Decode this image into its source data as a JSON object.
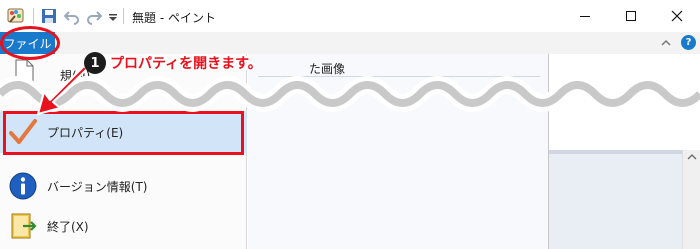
{
  "window": {
    "title": "無題 - ペイント",
    "icons": [
      "paint-app-icon",
      "save-icon",
      "undo-icon",
      "redo-icon",
      "customize-quick-access-icon",
      "minimize-icon",
      "maximize-icon",
      "close-icon"
    ]
  },
  "ribbon": {
    "file_tab_label": "ファイル",
    "help_glyph": "?",
    "accent_color": "#1979ca"
  },
  "backstage": {
    "recent_heading": "た画像",
    "menu_items": [
      {
        "label": "新規(N)",
        "icon": "new-file-icon"
      },
      {
        "label": "プロパティ(E)",
        "icon": "checkmark-icon",
        "highlighted": true
      },
      {
        "label": "バージョン情報(T)",
        "icon": "info-icon"
      },
      {
        "label": "終了(X)",
        "icon": "exit-icon"
      }
    ],
    "new_item_visible": "規(N)"
  },
  "annotation": {
    "step_number": "1",
    "instruction": "プロパティを開きます。",
    "highlight_color": "#e8111d"
  }
}
